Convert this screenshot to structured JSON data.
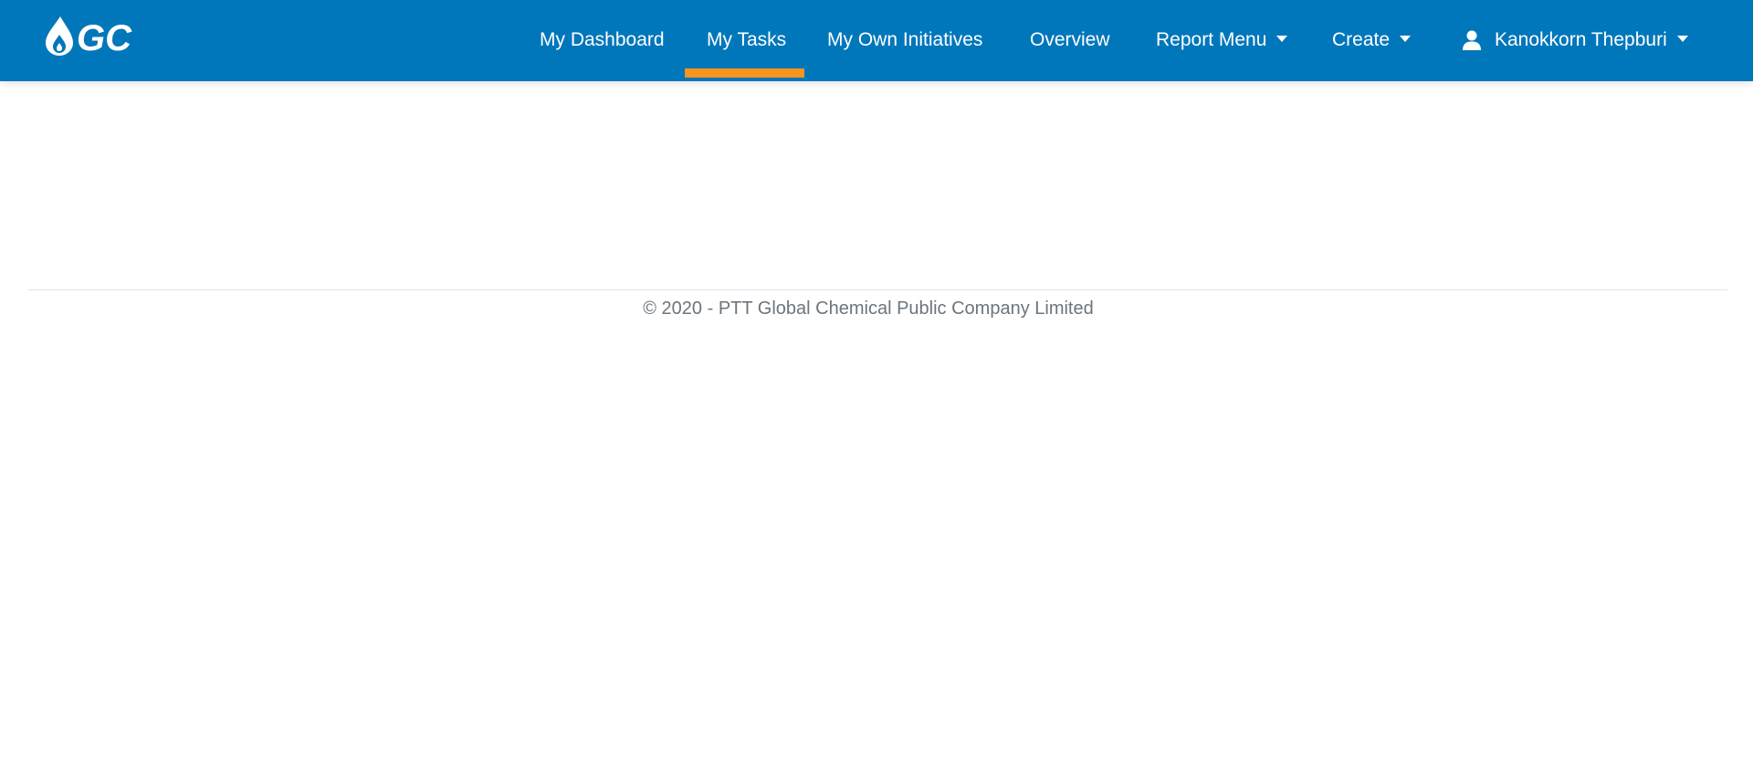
{
  "brand": {
    "logo_text": "GC",
    "logo_icon": "ptt-flame-drop-icon",
    "colors": {
      "navbar": "#0077bb",
      "active_indicator": "#f7941d"
    }
  },
  "nav": {
    "items": [
      {
        "label": "My Dashboard",
        "active": false,
        "dropdown": false
      },
      {
        "label": "My Tasks",
        "active": true,
        "dropdown": false
      },
      {
        "label": "My Own Initiatives",
        "active": false,
        "dropdown": false
      },
      {
        "label": "Overview",
        "active": false,
        "dropdown": false
      },
      {
        "label": "Report Menu",
        "active": false,
        "dropdown": true
      },
      {
        "label": "Create",
        "active": false,
        "dropdown": true
      }
    ],
    "user": {
      "name": "Kanokkorn Thepburi",
      "icon": "user-icon",
      "dropdown": true
    }
  },
  "footer": {
    "copyright": "© 2020 - PTT Global Chemical Public Company Limited"
  }
}
